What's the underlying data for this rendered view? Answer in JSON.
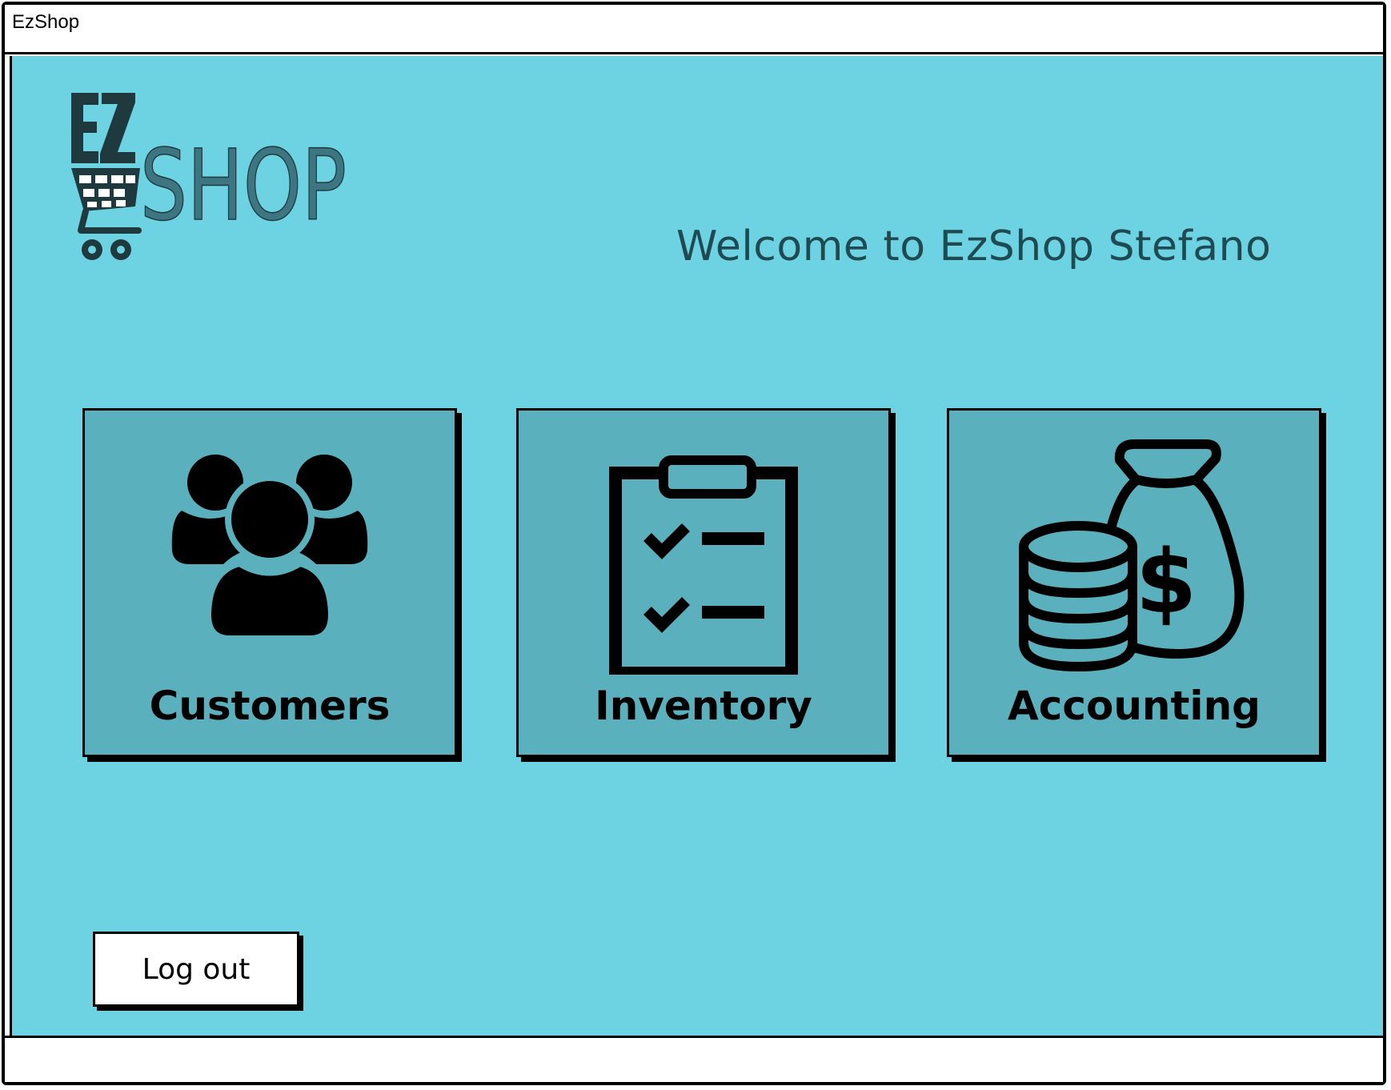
{
  "window": {
    "title": "EzShop"
  },
  "logo": {
    "text_ez": "EZ",
    "text_shop": "SHOP"
  },
  "header": {
    "welcome": "Welcome to EzShop Stefano"
  },
  "menu": {
    "items": [
      {
        "label": "Customers",
        "icon": "users-icon"
      },
      {
        "label": "Inventory",
        "icon": "clipboard-checklist-icon"
      },
      {
        "label": "Accounting",
        "icon": "money-bag-coins-icon"
      }
    ]
  },
  "actions": {
    "logout_label": "Log out"
  },
  "colors": {
    "background": "#6dd2e1",
    "card": "#5bb0bd",
    "logo_dark": "#1f3a3f",
    "logo_light": "#3d7681",
    "welcome_text": "#1f4a52"
  }
}
